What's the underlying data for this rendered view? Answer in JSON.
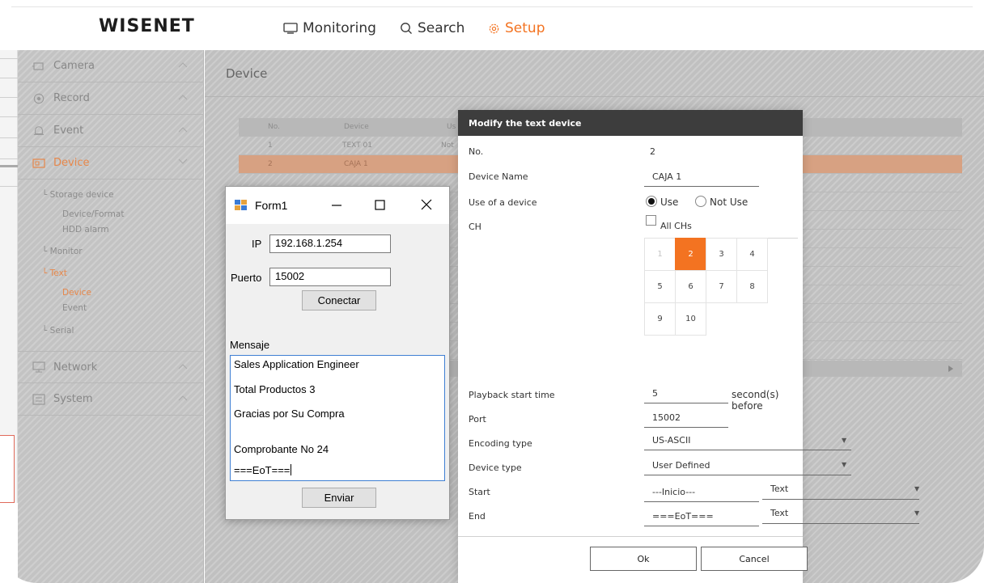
{
  "brand": {
    "logo": "WISENET"
  },
  "nav": [
    {
      "label": "Monitoring",
      "icon": "monitor-icon",
      "active": false
    },
    {
      "label": "Search",
      "icon": "search-icon",
      "active": false
    },
    {
      "label": "Setup",
      "icon": "gear-icon",
      "active": true
    }
  ],
  "colors": {
    "accent": "#f37321",
    "dialog_header": "#3d3d3d",
    "overlay": "#c6c6c6"
  },
  "sidebar": {
    "items": [
      {
        "label": "Camera",
        "icon": "camera-icon"
      },
      {
        "label": "Record",
        "icon": "record-icon"
      },
      {
        "label": "Event",
        "icon": "bell-icon"
      },
      {
        "label": "Device",
        "icon": "device-icon",
        "active": true
      },
      {
        "label": "Network",
        "icon": "network-icon"
      },
      {
        "label": "System",
        "icon": "system-icon"
      }
    ],
    "device_sub": {
      "storage": "Storage device",
      "format": "Device/Format",
      "hdd": "HDD alarm",
      "monitor": "Monitor",
      "text": "Text",
      "text_device": "Device",
      "text_event": "Event",
      "serial": "Serial"
    }
  },
  "main": {
    "title": "Device",
    "table": {
      "headers": [
        "No.",
        "Device"
      ],
      "rows": [
        {
          "no": "1",
          "device": "TEXT 01"
        },
        {
          "no": "2",
          "device": "CAJA 1"
        }
      ],
      "fragment_use": "Us",
      "fragment_not": "Not"
    }
  },
  "form1": {
    "title": "Form1",
    "ip_label": "IP",
    "ip_value": "192.168.1.254",
    "port_label": "Puerto",
    "port_value": "15002",
    "connect_button": "Conectar",
    "message_label": "Mensaje",
    "message_lines": [
      "Sales Application Engineer",
      "Total Productos 3",
      "Gracias por Su Compra",
      "Comprobante No 24",
      "===EoT==="
    ],
    "send_button": "Enviar"
  },
  "dialog": {
    "title": "Modify the text device",
    "no_label": "No.",
    "no_value": "2",
    "name_label": "Device Name",
    "name_value": "CAJA 1",
    "use_label": "Use of a device",
    "use_option": "Use",
    "not_use_option": "Not Use",
    "use_selected": "Use",
    "ch_label": "CH",
    "all_chs": "All CHs",
    "channels": [
      {
        "n": "1",
        "state": "disabled"
      },
      {
        "n": "2",
        "state": "selected"
      },
      {
        "n": "3",
        "state": "normal"
      },
      {
        "n": "4",
        "state": "normal"
      },
      {
        "n": "5",
        "state": "normal"
      },
      {
        "n": "6",
        "state": "normal"
      },
      {
        "n": "7",
        "state": "normal"
      },
      {
        "n": "8",
        "state": "normal"
      },
      {
        "n": "9",
        "state": "normal"
      },
      {
        "n": "10",
        "state": "normal"
      }
    ],
    "playback_label": "Playback start time",
    "playback_value": "5",
    "playback_suffix": "second(s) before",
    "port_label": "Port",
    "port_value": "15002",
    "encoding_label": "Encoding type",
    "encoding_value": "US-ASCII",
    "devtype_label": "Device type",
    "devtype_value": "User Defined",
    "start_label": "Start",
    "start_value": "---Inicio---",
    "start_format": "Text",
    "end_label": "End",
    "end_value": "===EoT===",
    "end_format": "Text",
    "ok_button": "Ok",
    "cancel_button": "Cancel"
  }
}
